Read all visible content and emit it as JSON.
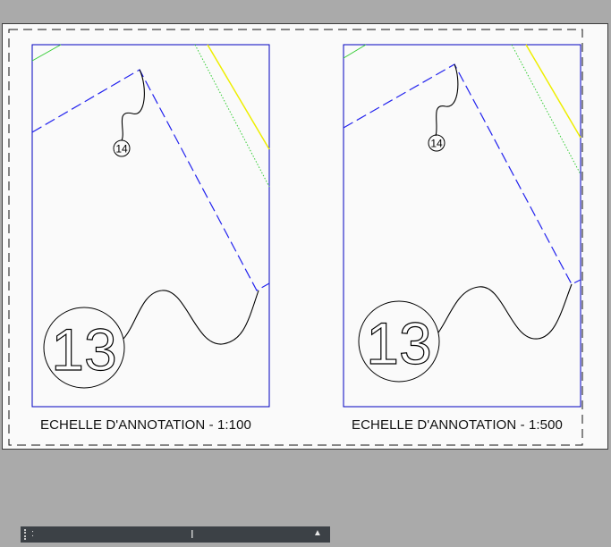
{
  "layout_sheet": {
    "viewports": [
      {
        "label": "ECHELLE D'ANNOTATION - 1:100",
        "big_tag": "13",
        "small_tag": "14"
      },
      {
        "label": "ECHELLE D'ANNOTATION - 1:500",
        "big_tag": "13",
        "small_tag": "14"
      }
    ],
    "colors": {
      "viewport_border": "#0000c0",
      "dashed_boundary": "#2222ee",
      "green_line": "#33cc33",
      "yellow_line": "#eeee00",
      "leader": "#000000"
    }
  },
  "command_line": {
    "prompt": ":",
    "placeholder": "",
    "arrow_icon": "▲",
    "cursor_icon": "I"
  }
}
